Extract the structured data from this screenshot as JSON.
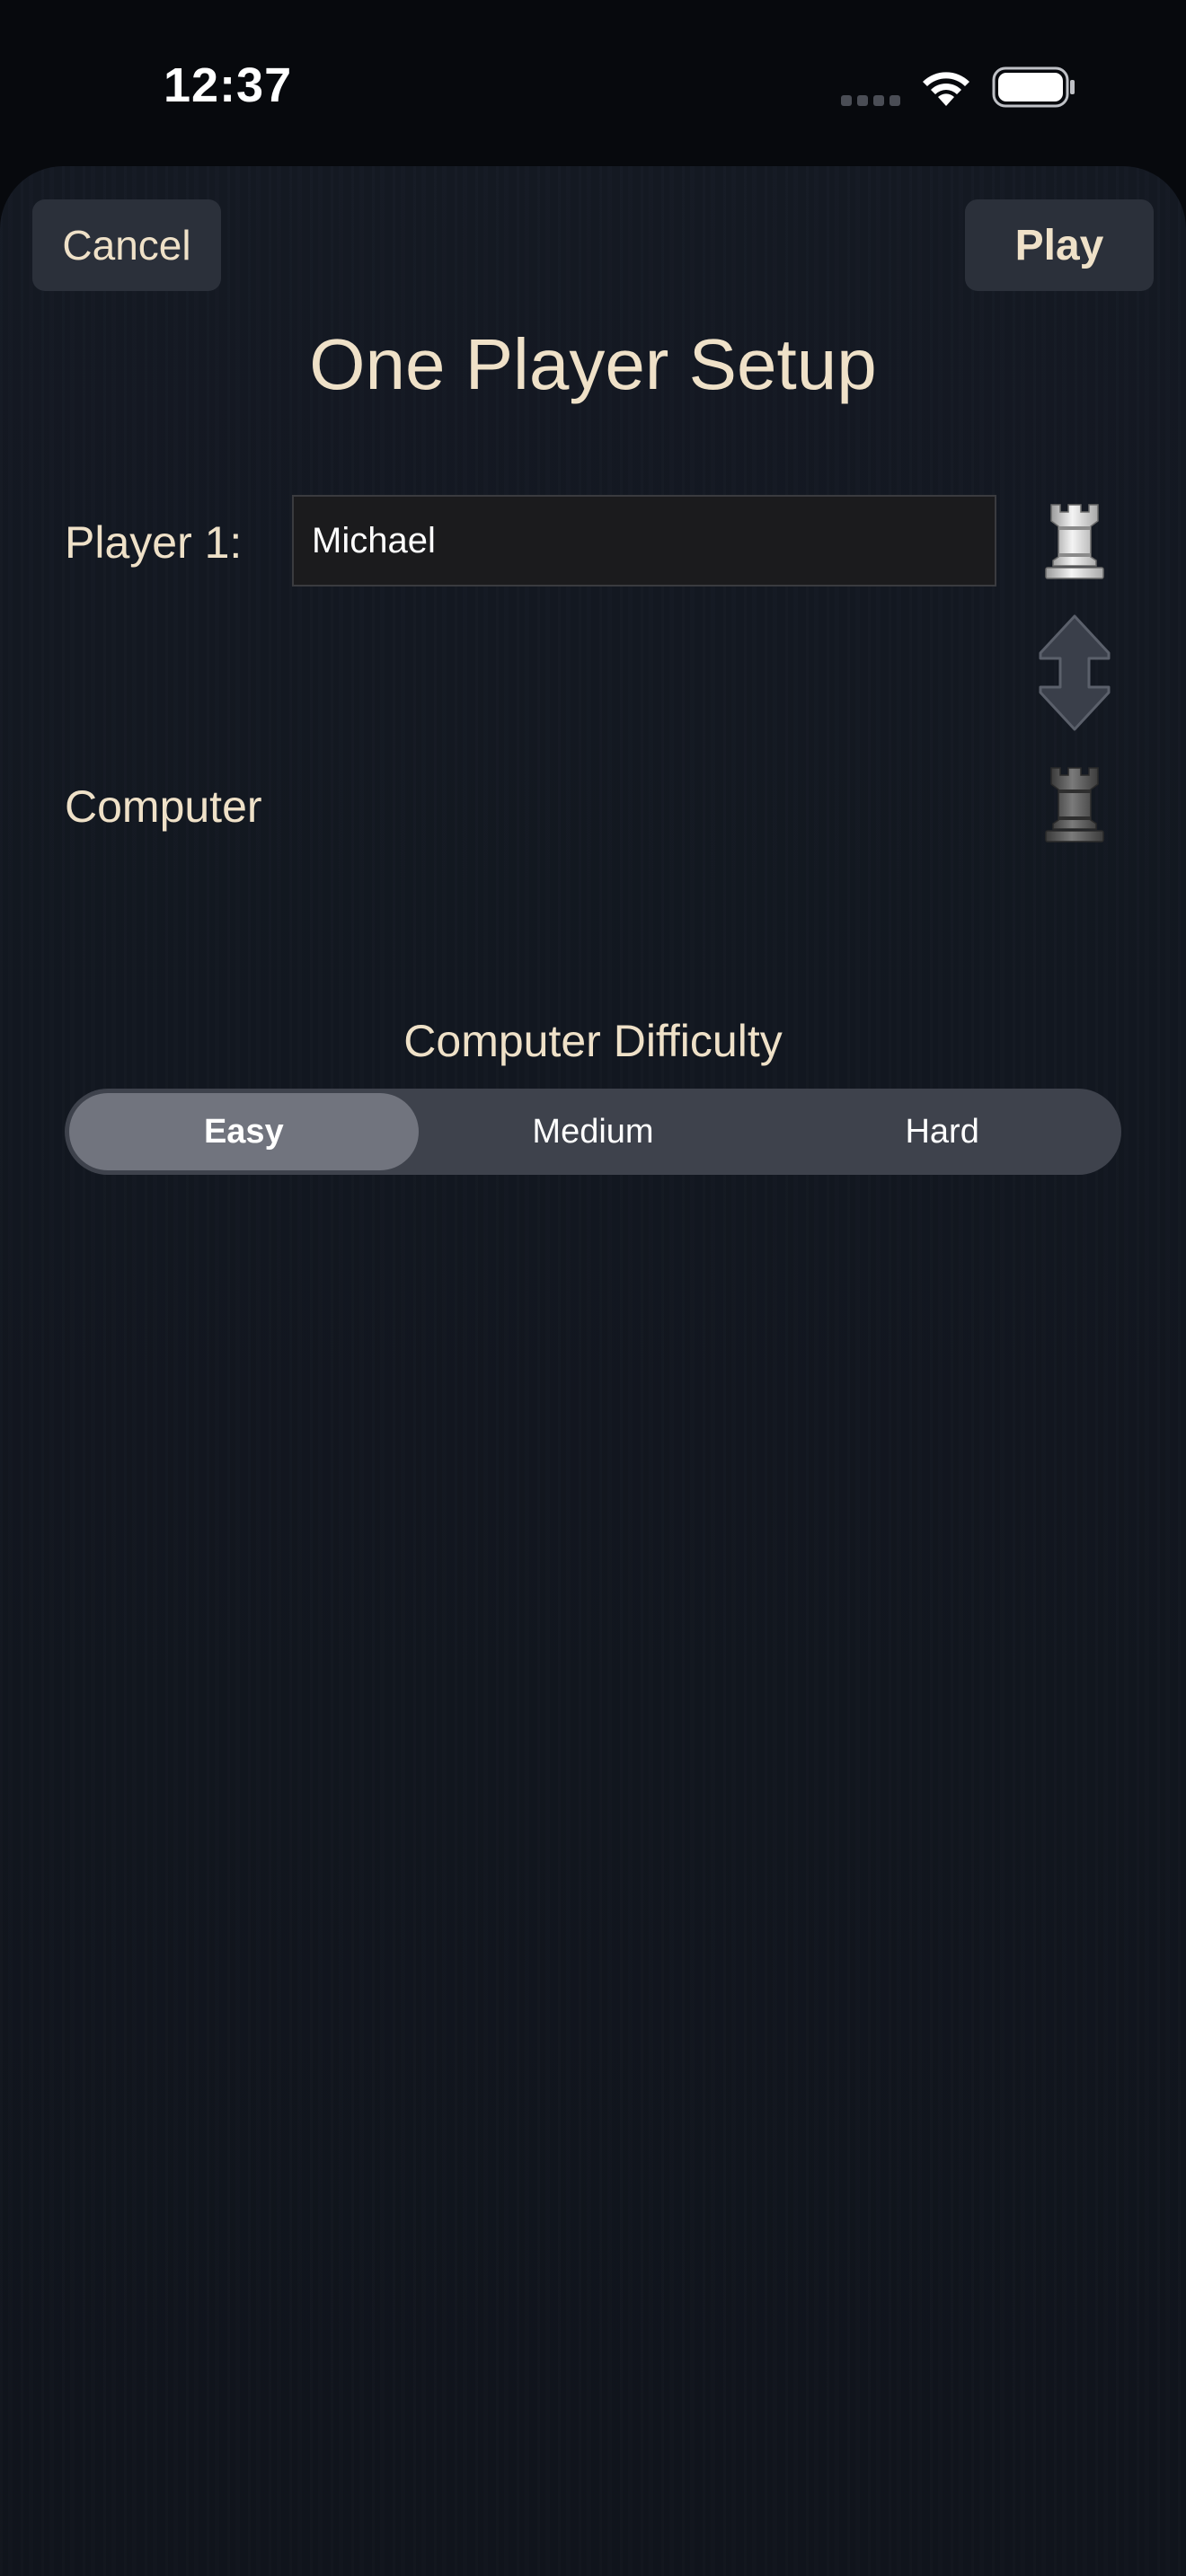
{
  "status_bar": {
    "time": "12:37",
    "signal_icon": "cellular-dots-icon",
    "wifi_icon": "wifi-icon",
    "battery_icon": "battery-icon"
  },
  "header": {
    "cancel_label": "Cancel",
    "play_label": "Play",
    "title": "One Player Setup"
  },
  "player1": {
    "label": "Player 1:",
    "name_value": "Michael",
    "piece_icon": "white-rook-icon"
  },
  "swap": {
    "icon": "swap-arrows-icon"
  },
  "computer": {
    "label": "Computer",
    "piece_icon": "black-rook-icon"
  },
  "difficulty": {
    "label": "Computer Difficulty",
    "options": [
      "Easy",
      "Medium",
      "Hard"
    ],
    "selected": "Easy"
  },
  "colors": {
    "accent_text": "#efe1c8",
    "button_bg": "#2b303a",
    "segment_bg": "#3e424c",
    "segment_selected": "#71747e"
  }
}
